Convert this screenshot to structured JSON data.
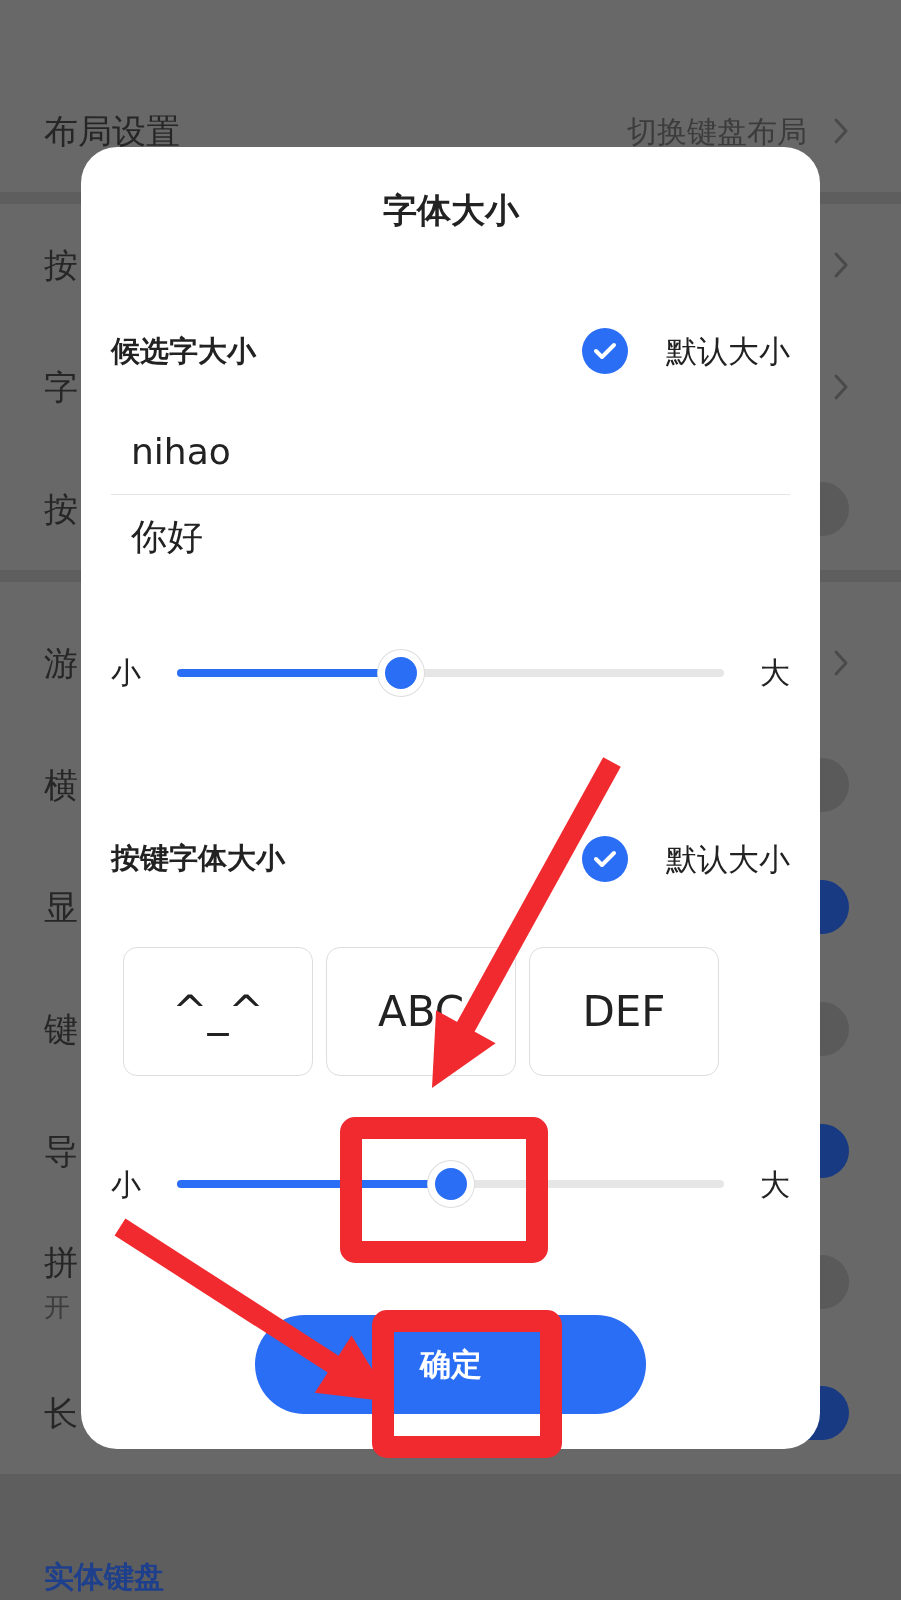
{
  "background": {
    "groups": [
      {
        "rows": [
          {
            "kind": "link",
            "label": "布局设置",
            "value": "切换键盘布局"
          }
        ]
      },
      {
        "rows": [
          {
            "kind": "link",
            "label": "按"
          },
          {
            "kind": "link",
            "label": "字"
          },
          {
            "kind": "toggle",
            "label": "按",
            "on": false
          }
        ]
      },
      {
        "rows": [
          {
            "kind": "link",
            "label": "游"
          },
          {
            "kind": "toggle",
            "label": "横",
            "on": false
          },
          {
            "kind": "toggle",
            "label": "显",
            "on": true
          },
          {
            "kind": "toggle",
            "label": "键",
            "on": false
          },
          {
            "kind": "toggle",
            "label": "导",
            "on": true
          },
          {
            "kind": "toggle",
            "label": "拼",
            "sublabel": "开",
            "on": false
          },
          {
            "kind": "toggle",
            "label": "长",
            "on": true
          }
        ]
      }
    ],
    "section_header": "实体键盘"
  },
  "dialog": {
    "title": "字体大小",
    "sections": [
      {
        "kind": "candidates",
        "heading": "候选字大小",
        "default_checked": true,
        "default_label": "默认大小",
        "samples": [
          "nihao",
          "你好"
        ],
        "slider": {
          "min_label": "小",
          "max_label": "大",
          "level": 0.41
        }
      },
      {
        "kind": "keys",
        "heading": "按键字体大小",
        "default_checked": true,
        "default_label": "默认大小",
        "keys": [
          "^_^",
          "ABC",
          "DEF"
        ],
        "slider": {
          "min_label": "小",
          "max_label": "大",
          "level": 0.5
        }
      }
    ],
    "confirm": "确定"
  },
  "annotations": [
    {
      "kind": "arrow"
    },
    {
      "kind": "box"
    },
    {
      "kind": "arrow"
    },
    {
      "kind": "box"
    }
  ]
}
